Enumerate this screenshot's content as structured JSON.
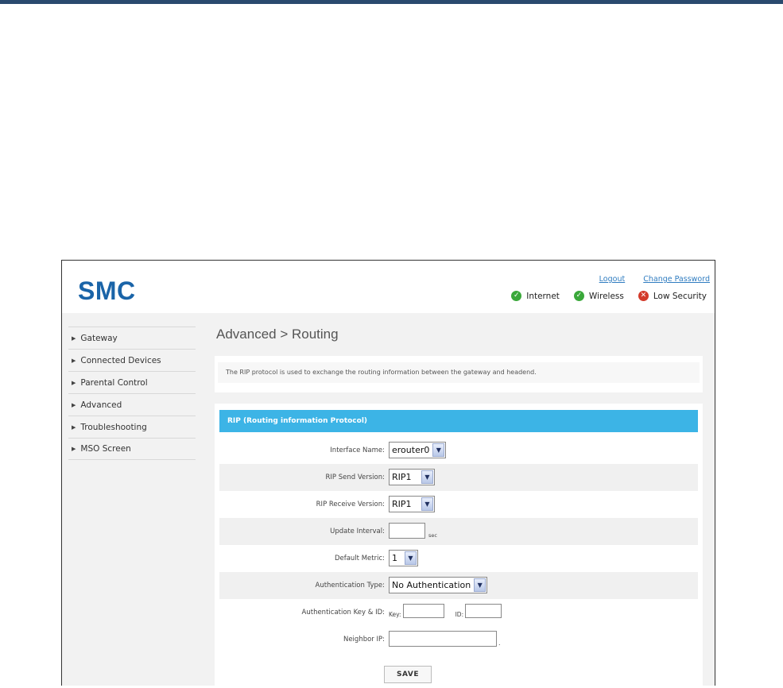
{
  "brand": {
    "logo": "SMC",
    "color": "#1a64a8"
  },
  "header": {
    "links": {
      "logout": "Logout",
      "change_password": "Change Password"
    },
    "status": [
      {
        "label": "Internet",
        "state": "ok",
        "icon": "check-circle-icon"
      },
      {
        "label": "Wireless",
        "state": "ok",
        "icon": "check-circle-icon"
      },
      {
        "label": "Low Security",
        "state": "bad",
        "icon": "x-circle-icon"
      }
    ]
  },
  "sidebar": {
    "items": [
      {
        "label": "Gateway"
      },
      {
        "label": "Connected Devices"
      },
      {
        "label": "Parental Control"
      },
      {
        "label": "Advanced"
      },
      {
        "label": "Troubleshooting"
      },
      {
        "label": "MSO Screen"
      }
    ]
  },
  "page": {
    "title": "Advanced > Routing",
    "description": "The RIP protocol is used to exchange the routing information between the gateway and headend."
  },
  "rip": {
    "heading": "RIP (Routing information Protocol)",
    "accent": "#3cb4e6",
    "interface_name": {
      "label": "Interface Name:",
      "value": "erouter0"
    },
    "send_version": {
      "label": "RIP Send Version:",
      "value": "RIP1"
    },
    "receive_version": {
      "label": "RIP Receive Version:",
      "value": "RIP1"
    },
    "update_interval": {
      "label": "Update Interval:",
      "value": "",
      "unit": "sec"
    },
    "default_metric": {
      "label": "Default Metric:",
      "value": "1"
    },
    "auth_type": {
      "label": "Authentication Type:",
      "value": "No Authentication"
    },
    "auth_key_id": {
      "label": "Authentication Key & ID:",
      "key_label": "Key:",
      "key_value": "",
      "id_label": "ID:",
      "id_value": ""
    },
    "neighbor_ip": {
      "label": "Neighbor IP:",
      "value": "",
      "suffix": "."
    },
    "save_label": "SAVE"
  }
}
